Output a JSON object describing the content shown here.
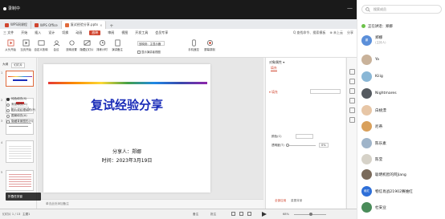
{
  "screen_share": {
    "status_label": "录制中"
  },
  "tabs": [
    {
      "label": "WPS网课程",
      "color": "#d0452f"
    },
    {
      "label": "WPS Office",
      "color": "#d0452f"
    },
    {
      "label": "复试经验分享.pptx",
      "color": "#e06a3c"
    }
  ],
  "menu": {
    "items": [
      "三 文件",
      "开始",
      "插入",
      "设计",
      "切换",
      "动画",
      "放映",
      "审阅",
      "视图",
      "开发工具",
      "会员专享"
    ],
    "selected": "放映",
    "right_items": [
      "Q 查找命令、搜索模板",
      "⊕ 未上云",
      "分享"
    ]
  },
  "ribbon": {
    "buttons": [
      "从头开始",
      "当页开始",
      "自定义放映",
      "会议",
      "放映设置",
      "隐藏幻灯片",
      "排练计时",
      "演讲备注"
    ],
    "monitor_label": "放映到：主显示器",
    "presenter_label": "显示演讲者视图",
    "pen_label": "手机遥控",
    "record_label": "屏幕录制"
  },
  "left_panel": {
    "tabs": [
      "大纲",
      "幻灯片"
    ],
    "thumb_numbers": [
      "1",
      "2",
      "3",
      "4",
      "5"
    ]
  },
  "slide": {
    "title": "复试经验分享",
    "presenter": "分享人：郑娜",
    "date": "时间：2023年3月19日"
  },
  "notes_placeholder": "单击此处添加备注",
  "properties": {
    "header": "对象属性 ▾",
    "tab": "填充",
    "section": "▾ 填充",
    "options": [
      "纯色填充(S)",
      "渐变填充(G)",
      "图片或纹理填充(P)",
      "图案填充(A)",
      "隐藏背景图形(H)"
    ],
    "selected_index": 0,
    "color_label": "颜色(C)",
    "transparency_label": "透明度(T)",
    "transparency_value": "0%",
    "apply_all": "全部应用",
    "reset": "重置背景"
  },
  "statusbar": {
    "page": "幻灯片 1 / 13",
    "theme": "主题1",
    "tooltip": "折叠任务窗",
    "notes_btn": "备注",
    "comments_btn": "批注",
    "zoom": "68%"
  },
  "members": {
    "search_placeholder": "搜索成员",
    "speaking": "正在讲话：郑娜",
    "list": [
      {
        "name": "郑娜",
        "sub": "(主持人)",
        "color": "#5b8fd9",
        "initial": "娜"
      },
      {
        "name": "Ya",
        "sub": "",
        "color": "#c9b29a",
        "initial": ""
      },
      {
        "name": "Kiiig",
        "sub": "",
        "color": "#8ab7d6",
        "initial": ""
      },
      {
        "name": "Nightmares",
        "sub": "",
        "color": "#555a60",
        "initial": ""
      },
      {
        "name": "白桃漂",
        "sub": "",
        "color": "#e7c6a6",
        "initial": ""
      },
      {
        "name": "尼蒂",
        "sub": "",
        "color": "#d9a05b",
        "initial": ""
      },
      {
        "name": "陈乐素",
        "sub": "",
        "color": "#9fb4c9",
        "initial": ""
      },
      {
        "name": "陈莹",
        "sub": "",
        "color": "#d6d2c8",
        "initial": ""
      },
      {
        "name": "聪明机智的阿Jiang",
        "sub": "",
        "color": "#7a6a5a",
        "initial": ""
      },
      {
        "name": "物信肖战21902赛维红",
        "sub": "",
        "color": "#2e6fd8",
        "initial": "维红"
      },
      {
        "name": "杜安业",
        "sub": "",
        "color": "#4a8c5a",
        "initial": ""
      }
    ]
  }
}
